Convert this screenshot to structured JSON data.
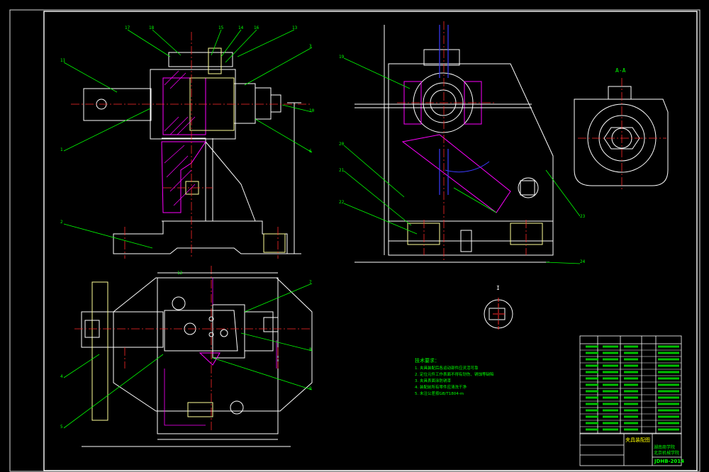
{
  "drawing": {
    "title_block": {
      "name": "夹具装配图",
      "school_line1": "湖南商学院",
      "school_line2": "北京机械学院",
      "drawing_no": "JDHB-2014"
    },
    "callouts_top_left": [
      "17",
      "18",
      "15",
      "14",
      "16",
      "13",
      "11",
      "1",
      "2",
      "3",
      "10",
      "6"
    ],
    "callouts_bottom_left": [
      "4",
      "5",
      "7",
      "8",
      "9",
      "12"
    ],
    "callouts_top_middle": [
      "19",
      "20",
      "21",
      "22",
      "23",
      "24"
    ],
    "section_label": "A-A",
    "detail_label": "I",
    "tech_requirements": {
      "heading": "技术要求：",
      "lines": [
        "1. 夹具装配后各运动部件应灵活可靠",
        "2. 定位元件工作表面不得有划伤、锈蚀等缺陷",
        "3. 夹具表面涂防锈漆",
        "4. 装配前所有零件应清洗干净",
        "5. 未注公差按GB/T1804-m"
      ]
    },
    "colors": {
      "background": "#000000",
      "frame": "#ffffff",
      "part_outline": "#ffffff",
      "centerline": "#ff2a2a",
      "leader": "#00ff00",
      "hatch": "#ff00ff",
      "dimension": "#ffffff",
      "tech_text": "#00ff00",
      "title_block_text": "#00ff00",
      "blue_lines": "#3b3bff",
      "yellow": "#ffff00"
    }
  }
}
